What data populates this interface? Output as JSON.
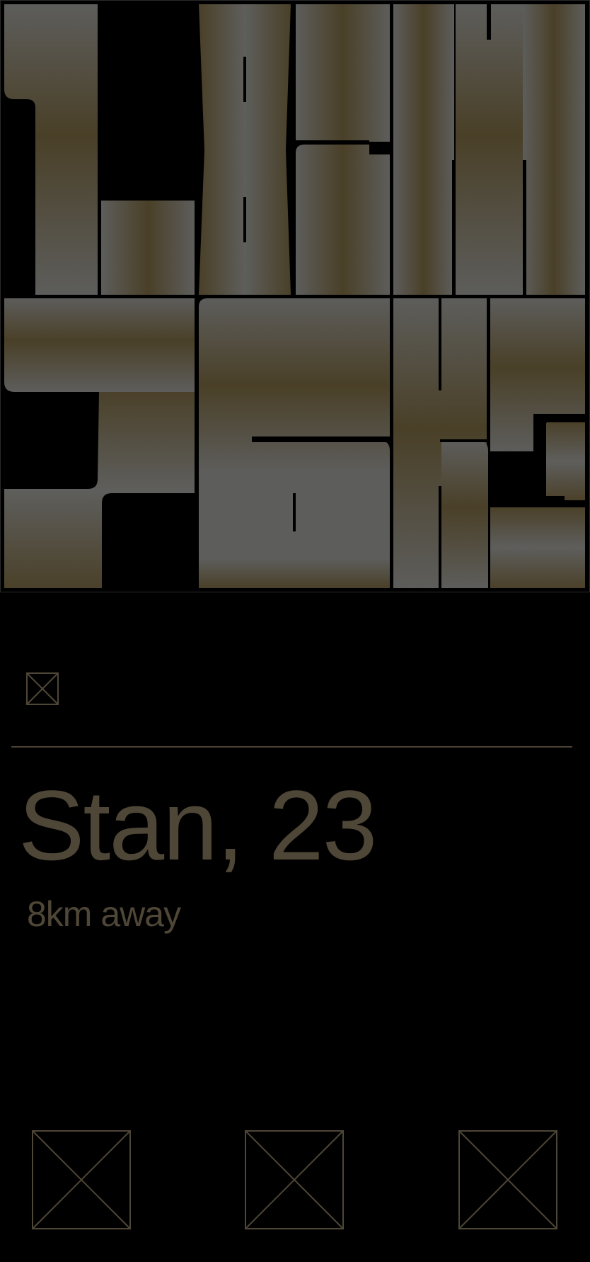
{
  "theme": {
    "background": "#000000",
    "accent": "#4e4636",
    "divider": "#4a4232"
  },
  "hero": {
    "image_alt": "Profile photo",
    "visual": "olive-grey gradient block lettering artwork"
  },
  "profile": {
    "name_age": "Stan, 23",
    "distance": "8km away"
  },
  "icons": {
    "top": "image-placeholder-icon",
    "actions": [
      {
        "name": "image-placeholder-icon"
      },
      {
        "name": "image-placeholder-icon"
      },
      {
        "name": "image-placeholder-icon"
      }
    ]
  }
}
